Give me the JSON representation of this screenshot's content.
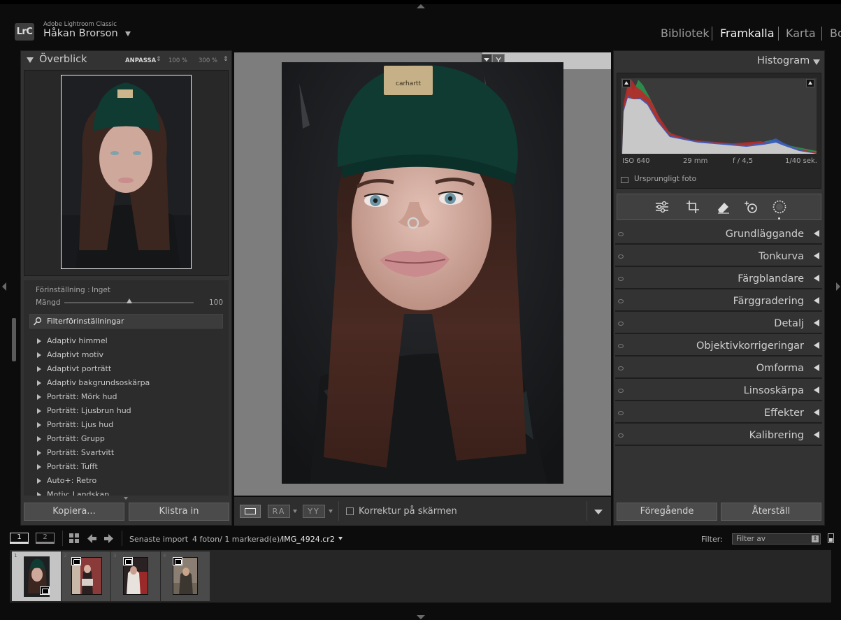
{
  "app": {
    "logo": "LrC",
    "name": "Adobe Lightroom Classic",
    "user": "Håkan Brorson"
  },
  "modules": [
    {
      "label": "Bibliotek",
      "active": false
    },
    {
      "label": "Framkalla",
      "active": true
    },
    {
      "label": "Karta",
      "active": false
    },
    {
      "label": "Bo",
      "active": false
    }
  ],
  "navigator": {
    "title": "Överblick",
    "fit_label": "ANPASSA",
    "zoom_1": "100 %",
    "zoom_2": "300 %"
  },
  "presets": {
    "setting_label": "Förinställning :",
    "setting_value": "Inget",
    "amount_label": "Mängd",
    "amount_value": "100",
    "amount_fraction": 0.5,
    "filter_placeholder": "Filterförinställningar",
    "items": [
      "Adaptiv himmel",
      "Adaptivt motiv",
      "Adaptivt porträtt",
      "Adaptiv bakgrundsoskärpa",
      "Porträtt: Mörk hud",
      "Porträtt: Ljusbrun hud",
      "Porträtt: Ljus hud",
      "Porträtt: Grupp",
      "Porträtt: Svartvitt",
      "Porträtt: Tufft",
      "Auto+: Retro",
      "Motiv: Landskap"
    ]
  },
  "left_buttons": {
    "copy": "Kopiera...",
    "paste": "Klistra in"
  },
  "histogram": {
    "title": "Histogram",
    "iso": "ISO 640",
    "focal": "29 mm",
    "aperture": "f / 4,5",
    "shutter": "1/40 sek.",
    "original_photo": "Ursprungligt foto"
  },
  "tools": [
    "sliders-icon",
    "crop-icon",
    "eraser-icon",
    "healing-icon",
    "mask-icon"
  ],
  "sections": [
    "Grundläggande",
    "Tonkurva",
    "Färgblandare",
    "Färggradering",
    "Detalj",
    "Objektivkorrigeringar",
    "Omforma",
    "Linsoskärpa",
    "Effekter",
    "Kalibrering"
  ],
  "right_buttons": {
    "previous": "Föregående",
    "reset": "Återställ"
  },
  "toolbar": {
    "ra": "RA",
    "yy": "YY",
    "softproof": "Korrektur på skärmen"
  },
  "filmstrip_bar": {
    "screen_1": "1",
    "screen_2": "2",
    "source": "Senaste import",
    "count": "4 foton/ 1 markerad(e)/",
    "filename": "IMG_4924.cr2",
    "filter_label": "Filter:",
    "filter_value": "Filter av"
  },
  "filmstrip": [
    {
      "index": "1",
      "selected": true
    },
    {
      "index": "2",
      "selected": false
    },
    {
      "index": "3",
      "selected": false
    },
    {
      "index": "4",
      "selected": false
    }
  ],
  "colors": {
    "panel": "#333333",
    "background": "#0c0c0c",
    "beanie": "#0f3b33"
  }
}
